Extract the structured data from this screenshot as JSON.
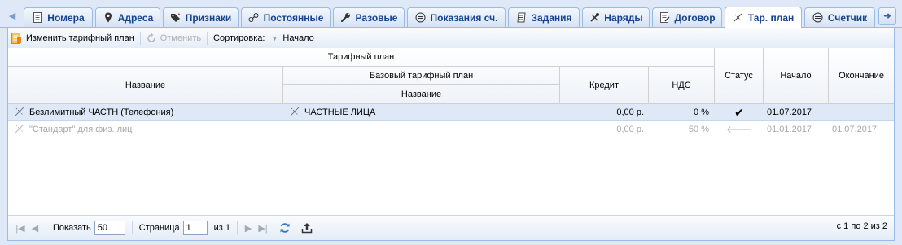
{
  "tabs": [
    {
      "label": "Номера",
      "icon": "document-icon",
      "active": false
    },
    {
      "label": "Адреса",
      "icon": "map-pin-icon",
      "active": false
    },
    {
      "label": "Признаки",
      "icon": "tags-icon",
      "active": false
    },
    {
      "label": "Постоянные",
      "icon": "link-icon",
      "active": false
    },
    {
      "label": "Разовые",
      "icon": "wrench-icon",
      "active": false
    },
    {
      "label": "Показания сч.",
      "icon": "meter-icon",
      "active": false
    },
    {
      "label": "Задания",
      "icon": "tasks-icon",
      "active": false
    },
    {
      "label": "Наряды",
      "icon": "tools-icon",
      "active": false
    },
    {
      "label": "Договор",
      "icon": "contract-icon",
      "active": false
    },
    {
      "label": "Тар. план",
      "icon": "tariff-icon",
      "active": true
    },
    {
      "label": "Счетчик",
      "icon": "meter-icon",
      "active": false
    }
  ],
  "toolbar": {
    "change_plan_label": "Изменить тарифный план",
    "cancel_label": "Отменить",
    "sort_label": "Сортировка:",
    "sort_value": "Начало"
  },
  "grid": {
    "group_header": "Тарифный план",
    "col_name": "Название",
    "base_plan_header": "Базовый тарифный план",
    "base_plan_name": "Название",
    "col_credit": "Кредит",
    "col_vat": "НДС",
    "col_status": "Статус",
    "col_start": "Начало",
    "col_end": "Окончание",
    "rows": [
      {
        "name": "Безлимитный ЧАСТН (Телефония)",
        "base": "ЧАСТНЫЕ ЛИЦА",
        "credit": "0,00 р.",
        "vat": "0 %",
        "status": "✔",
        "start": "01.07.2017",
        "end": ""
      },
      {
        "name": "\"Стандарт\" для физ. лиц",
        "base": "",
        "credit": "0,00 р.",
        "vat": "50 %",
        "status": "🡐",
        "start": "01.01.2017",
        "end": "01.07.2017"
      }
    ]
  },
  "pager": {
    "show_label": "Показать",
    "page_size": "50",
    "page_label": "Страница",
    "page_value": "1",
    "of_label": "из 1",
    "info": "с 1 по 2 из 2"
  },
  "colors": {
    "accent": "#15428b",
    "border": "#99bbe8",
    "selected_row": "#dfe8f6"
  }
}
